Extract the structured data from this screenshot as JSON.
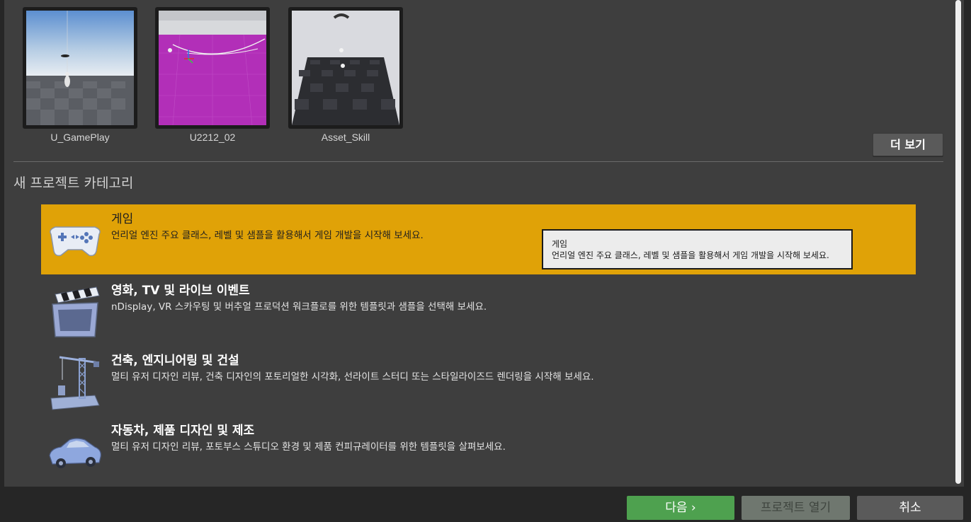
{
  "recent_projects": [
    {
      "name": "U_GamePlay"
    },
    {
      "name": "U2212_02"
    },
    {
      "name": "Asset_Skill"
    }
  ],
  "more_button": "더 보기",
  "section_title": "새 프로젝트 카테고리",
  "categories": [
    {
      "title": "게임",
      "description": "언리얼 엔진 주요 클래스, 레벨 및 샘플을 활용해서 게임 개발을 시작해 보세요.",
      "icon": "gamepad-icon",
      "selected": true
    },
    {
      "title": "영화, TV 및 라이브 이벤트",
      "description": "nDisplay, VR 스카우팅 및 버추얼 프로덕션 워크플로를 위한 템플릿과 샘플을 선택해 보세요.",
      "icon": "clapperboard-icon"
    },
    {
      "title": "건축, 엔지니어링 및 건설",
      "description": "멀티 유저 디자인 리뷰, 건축 디자인의 포토리얼한 시각화, 선라이트 스터디 또는 스타일라이즈드 렌더링을 시작해 보세요.",
      "icon": "crane-icon"
    },
    {
      "title": "자동차, 제품 디자인 및 제조",
      "description": "멀티 유저 디자인 리뷰, 포토부스 스튜디오 환경 및 제품 컨피규레이터를 위한 템플릿을 살펴보세요.",
      "icon": "car-icon"
    }
  ],
  "tooltip": {
    "title": "게임",
    "description": "언리얼 엔진 주요 클래스, 레벨 및 샘플을 활용해서 게임 개발을 시작해 보세요."
  },
  "footer": {
    "next": "다음 ›",
    "open_project": "프로젝트 열기",
    "cancel": "취소"
  },
  "colors": {
    "selected_category": "#e0a207",
    "next_button": "#4ea14f"
  }
}
